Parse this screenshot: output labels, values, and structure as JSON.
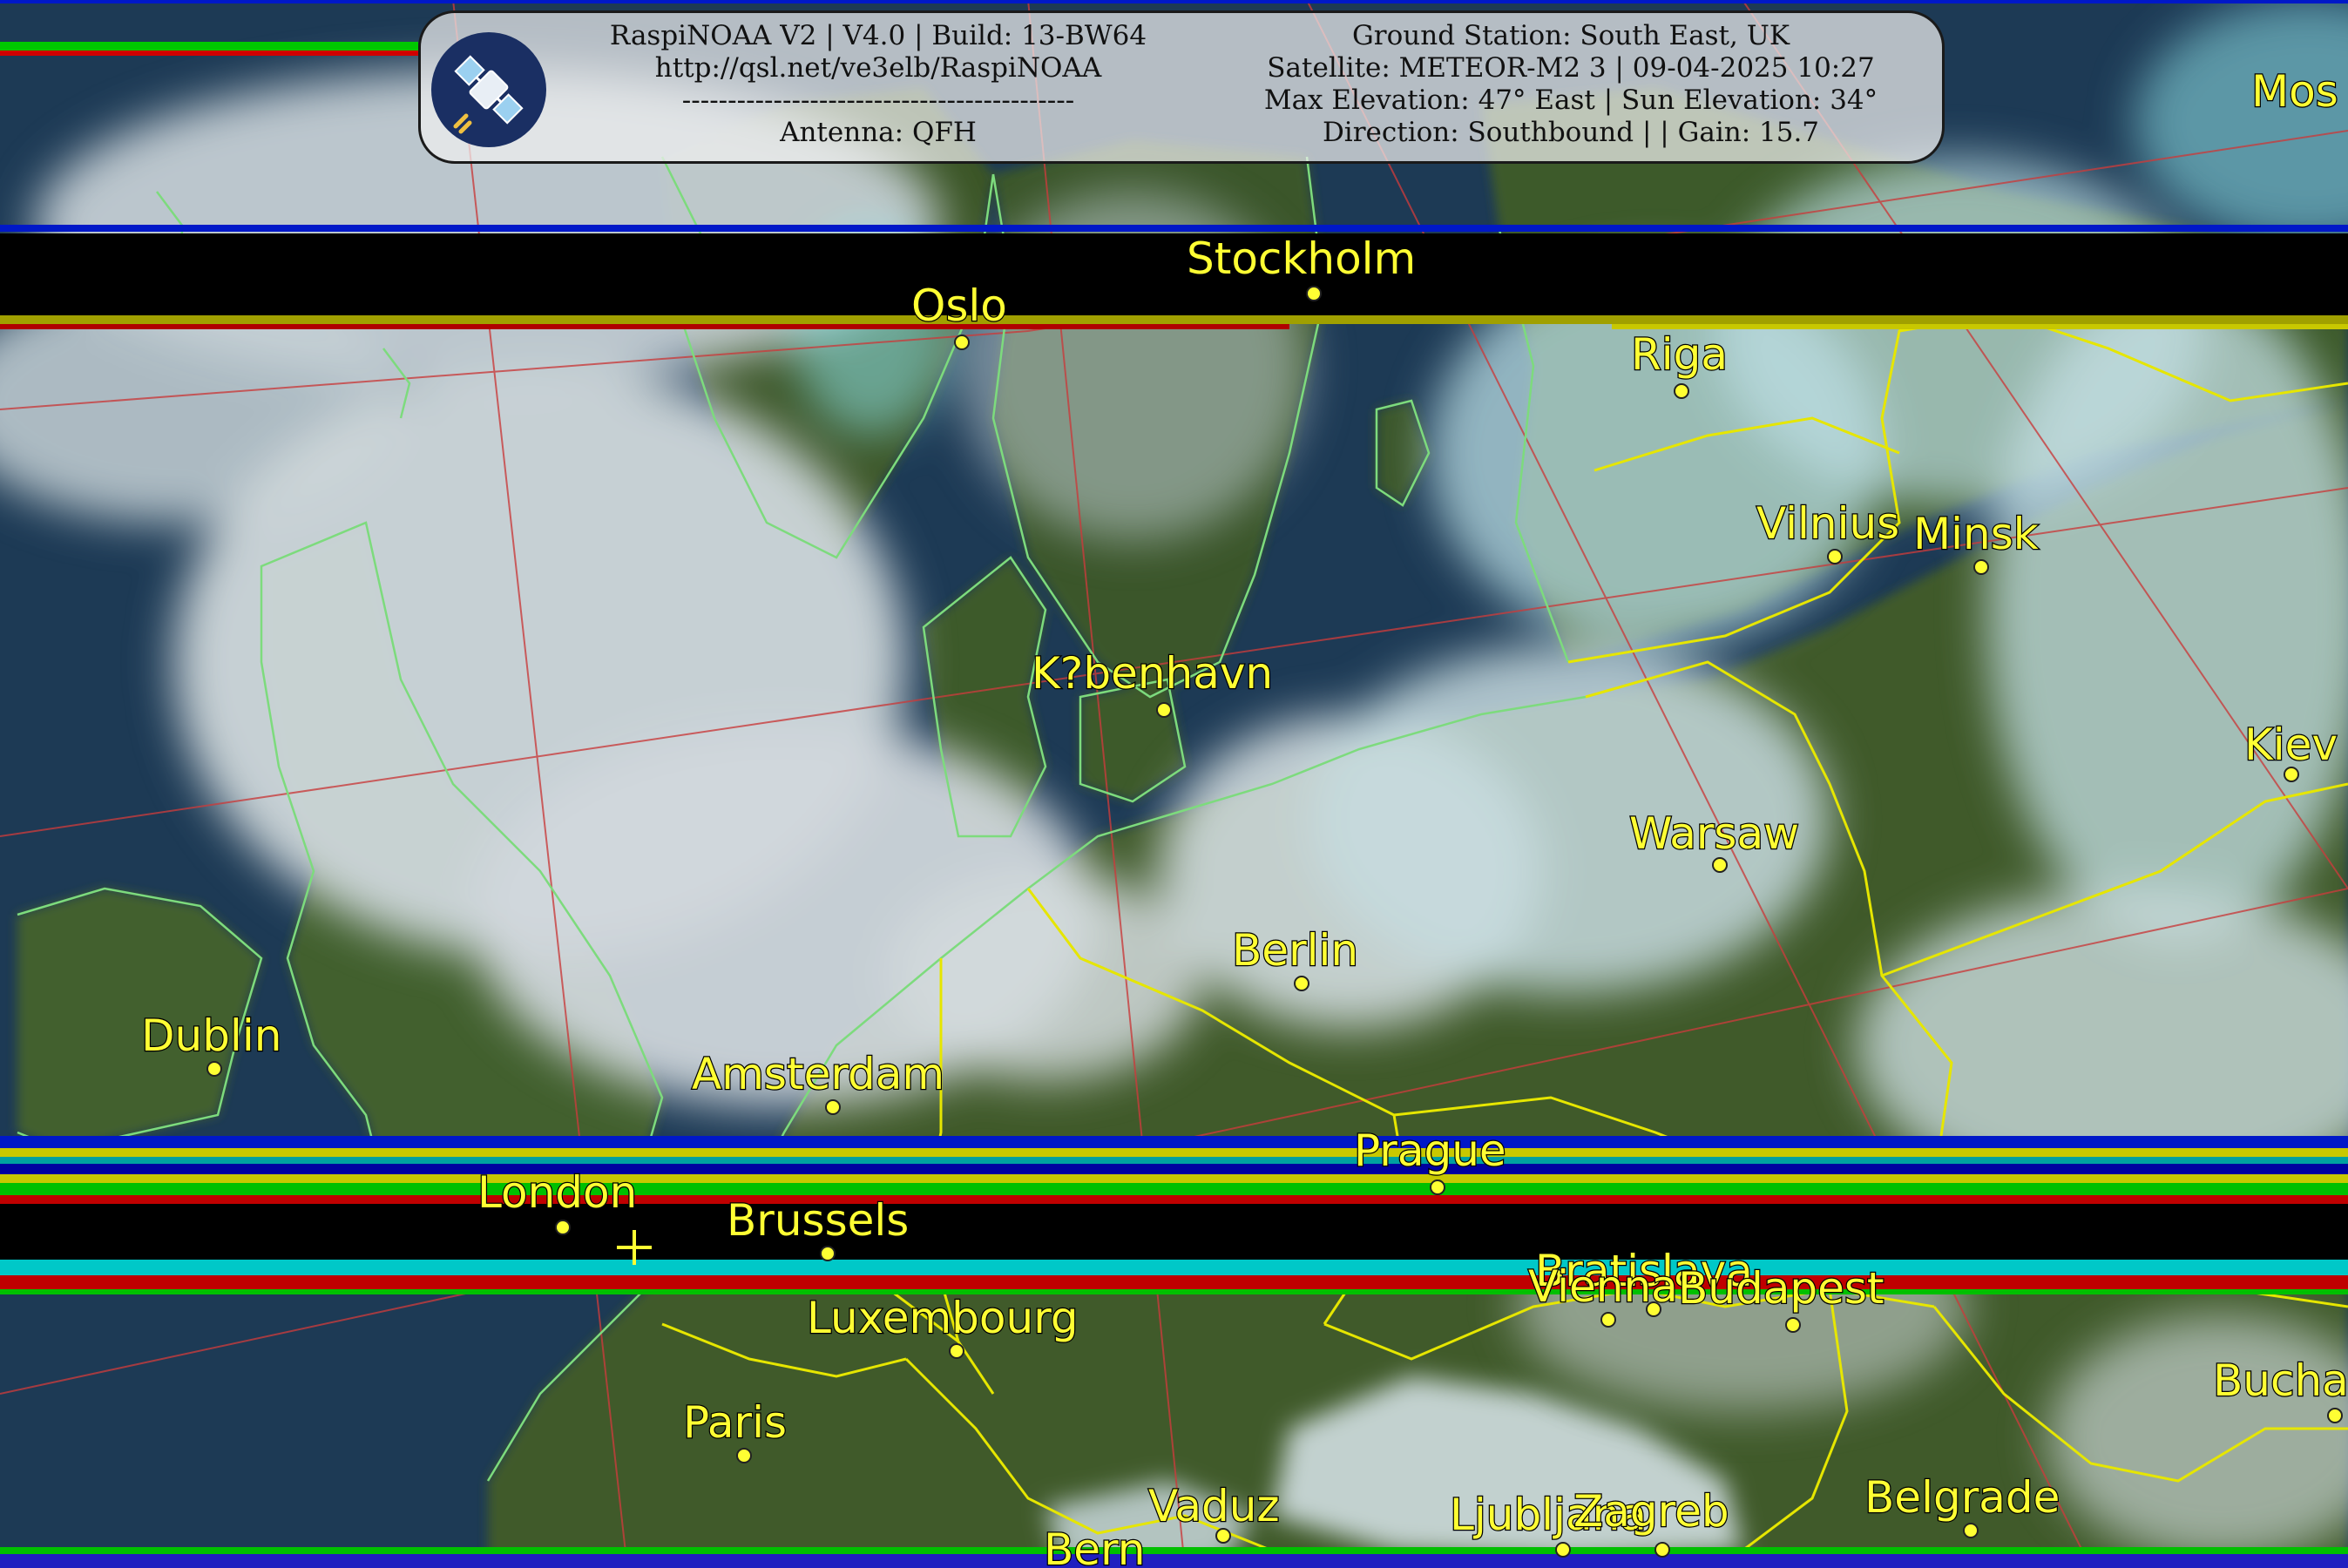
{
  "header": {
    "left_lines": [
      "RaspiNOAA V2 | V4.0 | Build: 13-BW64",
      "http://qsl.net/ve3elb/RaspiNOAA",
      "-------------------------------------------",
      "Antenna: QFH"
    ],
    "right_lines": [
      "Ground Station: South East, UK",
      "Satellite: METEOR-M2 3 | 09-04-2025 10:27",
      "Max Elevation: 47° East | Sun Elevation: 34°",
      "Direction: Southbound | | Gain: 15.7"
    ],
    "logo_icon": "satellite-icon"
  },
  "cities": [
    "Stockholm",
    "Oslo",
    "Riga",
    "Vilnius",
    "Minsk",
    "K?benhavn",
    "Kiev",
    "Warsaw",
    "Berlin",
    "Dublin",
    "Amsterdam",
    "Prague",
    "London",
    "Brussels",
    "Luxembourg",
    "Bratislava",
    "Vienna",
    "Budapest",
    "Paris",
    "Bucha",
    "Vaduz",
    "Ljubljana",
    "Zagreb",
    "Belgrade",
    "Bern",
    "Mos"
  ],
  "colors": {
    "city_label": "#ffff33",
    "coastline": "#7ddb7d",
    "border": "#e6e600",
    "graticule": "#c83c3c",
    "sea": "#1d3a55",
    "land": "#3e5a2c",
    "cloud": "#c5d2d6",
    "snow_cyan": "#8fe3ea"
  }
}
